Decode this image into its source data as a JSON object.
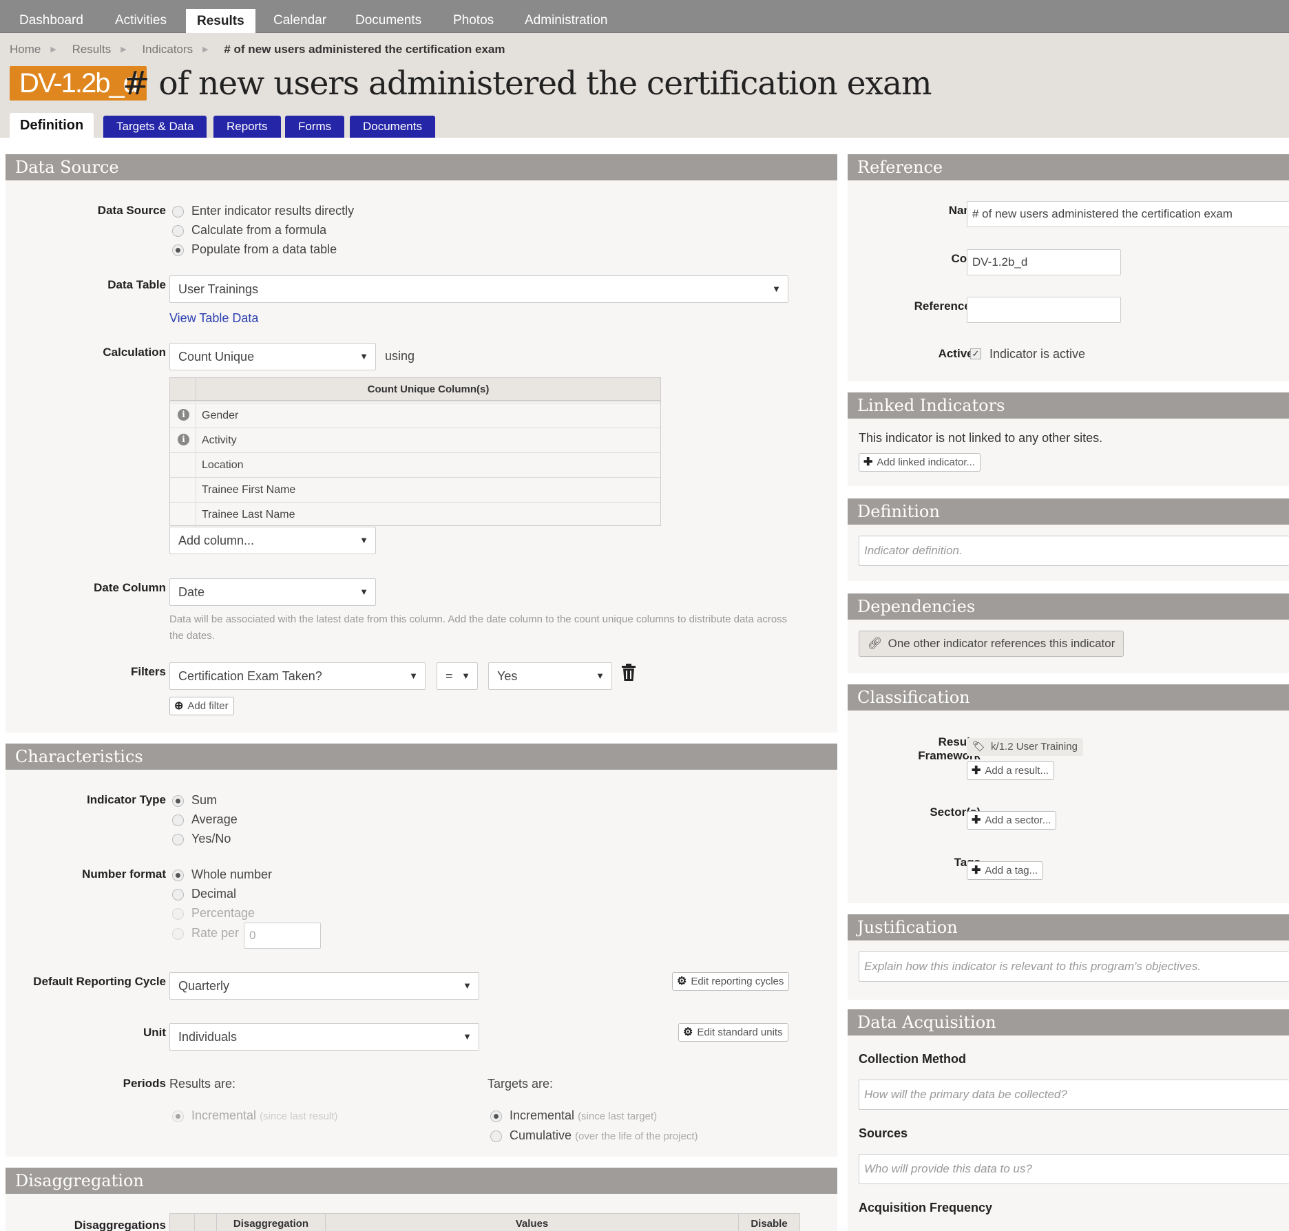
{
  "nav": {
    "items": [
      "Dashboard",
      "Activities",
      "Results",
      "Calendar",
      "Documents",
      "Photos",
      "Administration"
    ],
    "active": "Results"
  },
  "breadcrumb": {
    "items": [
      "Home",
      "Results",
      "Indicators"
    ],
    "current": "# of new users administered the certification exam"
  },
  "page": {
    "code": "DV-1.2b_d",
    "title": "# of new users administered the certification exam"
  },
  "tabs": [
    "Definition",
    "Targets & Data",
    "Reports",
    "Forms",
    "Documents"
  ],
  "data_source": {
    "heading": "Data Source",
    "source_label": "Data Source",
    "source_options": [
      "Enter indicator results directly",
      "Calculate from a formula",
      "Populate from a data table"
    ],
    "source_selected": "Populate from a data table",
    "table_label": "Data Table",
    "table_value": "User Trainings",
    "view_link": "View Table Data",
    "calc_label": "Calculation",
    "calc_value": "Count Unique",
    "using": "using",
    "columns_header": "Count Unique Column(s)",
    "columns": [
      "Gender",
      "Activity",
      "Location",
      "Trainee First Name",
      "Trainee Last Name"
    ],
    "add_column": "Add column...",
    "date_label": "Date Column",
    "date_value": "Date",
    "date_hint": "Data will be associated with the latest date from this column. Add the date column to the count unique columns to distribute data across the dates.",
    "filters_label": "Filters",
    "filter_field": "Certification Exam Taken?",
    "filter_op": "=",
    "filter_value": "Yes",
    "add_filter": "Add filter"
  },
  "characteristics": {
    "heading": "Characteristics",
    "type_label": "Indicator Type",
    "type_options": [
      "Sum",
      "Average",
      "Yes/No"
    ],
    "type_selected": "Sum",
    "format_label": "Number format",
    "format_options": [
      "Whole number",
      "Decimal",
      "Percentage",
      "Rate per"
    ],
    "format_selected": "Whole number",
    "rate_value": "0",
    "cycle_label": "Default Reporting Cycle",
    "cycle_value": "Quarterly",
    "edit_cycles": "Edit reporting cycles",
    "unit_label": "Unit",
    "unit_value": "Individuals",
    "edit_units": "Edit standard units",
    "periods_label": "Periods",
    "results_are": "Results are:",
    "results_option": "Incremental",
    "results_option_note": "(since last result)",
    "targets_are": "Targets are:",
    "targets_options": [
      {
        "label": "Incremental",
        "note": "(since last target)"
      },
      {
        "label": "Cumulative",
        "note": "(over the life of the project)"
      }
    ]
  },
  "disaggregation": {
    "heading": "Disaggregation",
    "label": "Disaggregations",
    "columns": [
      "Disaggregation",
      "Values",
      "Disable"
    ]
  },
  "reference": {
    "heading": "Reference",
    "name_label": "Name",
    "name_value": "# of new users administered the certification exam",
    "code_label": "Code",
    "code_value": "DV-1.2b_d",
    "ref_label": "Reference #",
    "ref_value": "",
    "active_label": "Active?",
    "active_text": "Indicator is active"
  },
  "linked": {
    "heading": "Linked Indicators",
    "text": "This indicator is not linked to any other sites.",
    "add": "Add linked indicator..."
  },
  "definition": {
    "heading": "Definition",
    "placeholder": "Indicator definition."
  },
  "dependencies": {
    "heading": "Dependencies",
    "button": "One other indicator references this indicator"
  },
  "classification": {
    "heading": "Classification",
    "framework_label_1": "Results",
    "framework_label_2": "Framework",
    "framework_tag": "k/1.2 User Training",
    "add_result": "Add a result...",
    "sector_label": "Sector(s)",
    "add_sector": "Add a sector...",
    "tags_label": "Tags",
    "add_tag": "Add a tag..."
  },
  "justification": {
    "heading": "Justification",
    "placeholder": "Explain how this indicator is relevant to this program's objectives."
  },
  "acquisition": {
    "heading": "Data Acquisition",
    "method_label": "Collection Method",
    "method_placeholder": "How will the primary data be collected?",
    "sources_label": "Sources",
    "sources_placeholder": "Who will provide this data to us?",
    "frequency_label": "Acquisition Frequency"
  }
}
